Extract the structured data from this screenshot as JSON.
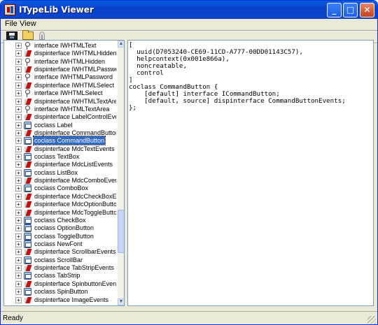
{
  "window": {
    "title": "ITypeLib Viewer"
  },
  "caption_buttons": {
    "minimize": "_",
    "maximize": "□",
    "close": "✕"
  },
  "menu": [
    "File",
    "View"
  ],
  "toolbar": {
    "buttons": [
      "save-icon",
      "open-folder-icon",
      "key-icon"
    ]
  },
  "tree": {
    "items": [
      {
        "type": "interface",
        "label": "interface IWHTMLText"
      },
      {
        "type": "dispinterface",
        "label": "dispinterface IWHTMLHidden"
      },
      {
        "type": "interface",
        "label": "interface IWHTMLHidden"
      },
      {
        "type": "dispinterface",
        "label": "dispinterface IWHTMLPassword"
      },
      {
        "type": "interface",
        "label": "interface IWHTMLPassword"
      },
      {
        "type": "dispinterface",
        "label": "dispinterface IWHTMLSelect"
      },
      {
        "type": "interface",
        "label": "interface IWHTMLSelect"
      },
      {
        "type": "dispinterface",
        "label": "dispinterface IWHTMLTextArea"
      },
      {
        "type": "interface",
        "label": "interface IWHTMLTextArea"
      },
      {
        "type": "dispinterface",
        "label": "dispinterface LabelControlEvents"
      },
      {
        "type": "coclass",
        "label": "coclass Label"
      },
      {
        "type": "dispinterface",
        "label": "dispinterface CommandButtonEver"
      },
      {
        "type": "coclass",
        "label": "coclass CommandButton",
        "selected": true
      },
      {
        "type": "dispinterface",
        "label": "dispinterface MdcTextEvents"
      },
      {
        "type": "coclass",
        "label": "coclass TextBox"
      },
      {
        "type": "dispinterface",
        "label": "dispinterface MdcListEvents"
      },
      {
        "type": "coclass",
        "label": "coclass ListBox"
      },
      {
        "type": "dispinterface",
        "label": "dispinterface MdcComboEvents"
      },
      {
        "type": "coclass",
        "label": "coclass ComboBox"
      },
      {
        "type": "dispinterface",
        "label": "dispinterface MdcCheckBoxEvents"
      },
      {
        "type": "dispinterface",
        "label": "dispinterface MdcOptionButtonEve"
      },
      {
        "type": "dispinterface",
        "label": "dispinterface MdcToggleButtonEve"
      },
      {
        "type": "coclass",
        "label": "coclass CheckBox"
      },
      {
        "type": "coclass",
        "label": "coclass OptionButton"
      },
      {
        "type": "coclass",
        "label": "coclass ToggleButton"
      },
      {
        "type": "coclass",
        "label": "coclass NewFont"
      },
      {
        "type": "dispinterface",
        "label": "dispinterface ScrollbarEvents"
      },
      {
        "type": "coclass",
        "label": "coclass ScrollBar"
      },
      {
        "type": "dispinterface",
        "label": "dispinterface TabStripEvents"
      },
      {
        "type": "coclass",
        "label": "coclass TabStrip"
      },
      {
        "type": "dispinterface",
        "label": "dispinterface SpinbuttonEvents"
      },
      {
        "type": "coclass",
        "label": "coclass SpinButton"
      },
      {
        "type": "dispinterface",
        "label": "dispinterface ImageEvents"
      }
    ]
  },
  "code": "[\n  uuid(D7053240-CE69-11CD-A777-00DD01143C57),\n  helpcontext(0x001e866a),\n  noncreatable,\n  control\n]\ncoclass CommandButton {\n    [default] interface ICommandButton;\n    [default, source] dispinterface CommandButtonEvents;\n};",
  "status": {
    "text": "Ready"
  },
  "colors": {
    "titlebar": "#0a4ed4",
    "selection": "#316ac5",
    "chrome": "#ece9d8",
    "panel_border": "#7f9db9"
  }
}
